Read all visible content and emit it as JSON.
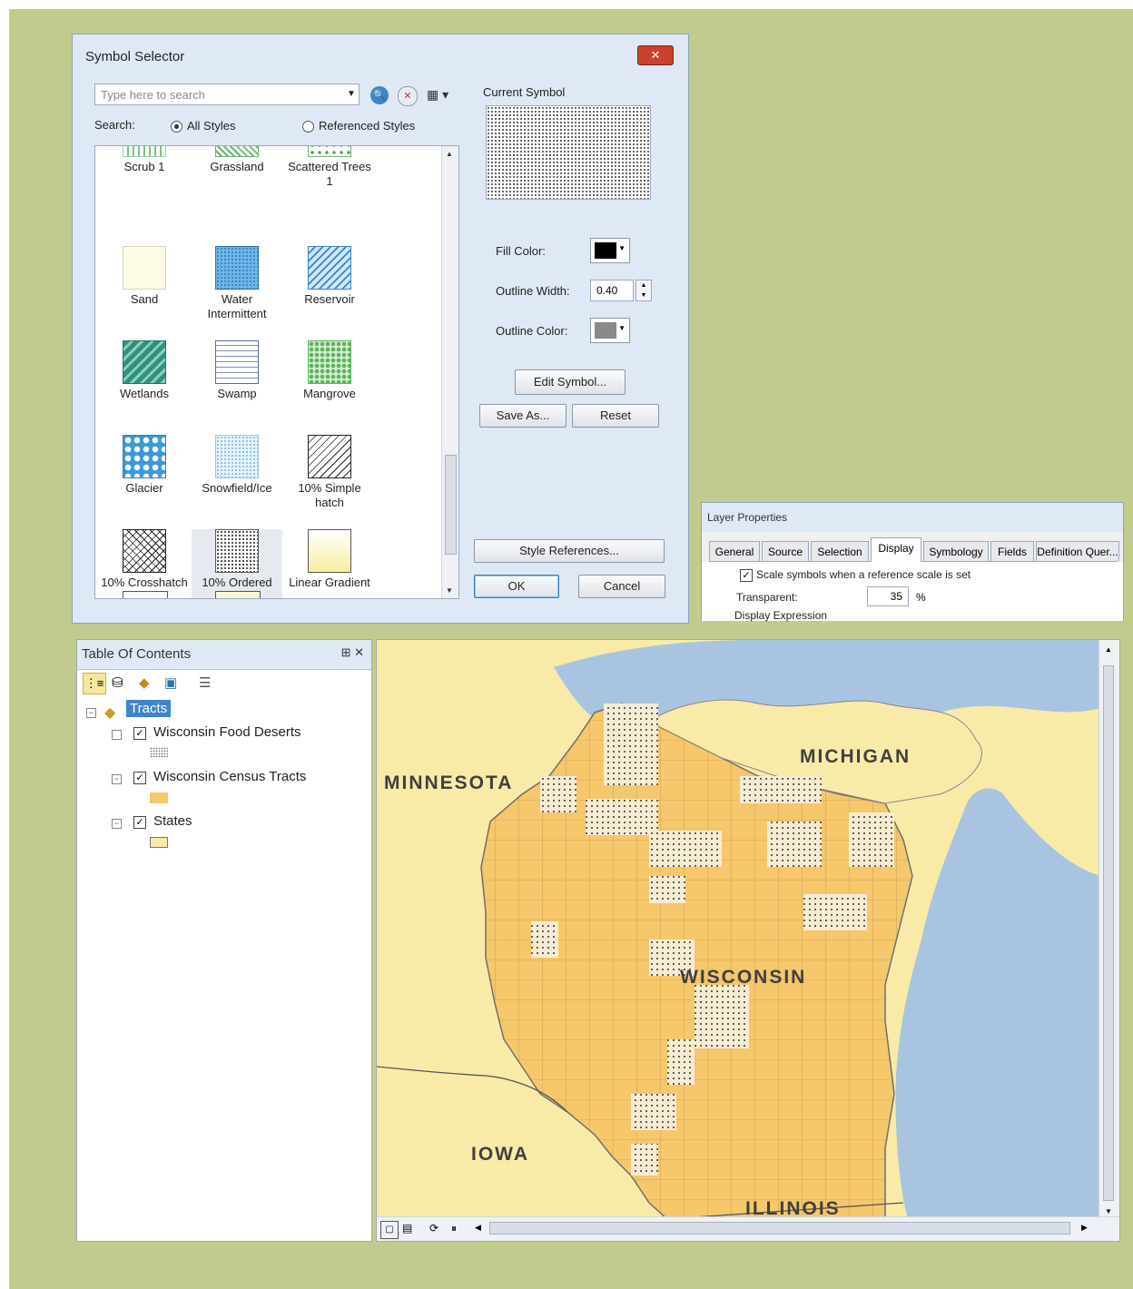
{
  "symbol_selector": {
    "title": "Symbol Selector",
    "close": "✕",
    "search_placeholder": "Type here to search",
    "search_label": "Search:",
    "radio_all": "All Styles",
    "radio_referenced": "Referenced Styles",
    "current_symbol_label": "Current Symbol",
    "fill_color_label": "Fill Color:",
    "outline_width_label": "Outline Width:",
    "outline_width_value": "0.40",
    "outline_color_label": "Outline Color:",
    "edit_symbol": "Edit Symbol...",
    "save_as": "Save As...",
    "reset": "Reset",
    "style_references": "Style References...",
    "ok": "OK",
    "cancel": "Cancel",
    "symbols": [
      {
        "name": "Scrub 1"
      },
      {
        "name": "Grassland"
      },
      {
        "name": "Scattered Trees 1"
      },
      {
        "name": "Sand"
      },
      {
        "name": "Water Intermittent"
      },
      {
        "name": "Reservoir"
      },
      {
        "name": "Wetlands"
      },
      {
        "name": "Swamp"
      },
      {
        "name": "Mangrove"
      },
      {
        "name": "Glacier"
      },
      {
        "name": "Snowfield/Ice"
      },
      {
        "name": "10% Simple hatch"
      },
      {
        "name": "10% Crosshatch"
      },
      {
        "name": "10% Ordered Stipple"
      },
      {
        "name": "Linear Gradient"
      }
    ]
  },
  "layer_properties": {
    "title": "Layer Properties",
    "tabs": [
      "General",
      "Source",
      "Selection",
      "Display",
      "Symbology",
      "Fields",
      "Definition Quer..."
    ],
    "active_tab": "Display",
    "scale_symbols": "Scale symbols when a reference scale is set",
    "transparent_label": "Transparent:",
    "transparent_value": "35",
    "transparent_unit": "%",
    "display_expression": "Display Expression"
  },
  "toc": {
    "title": "Table Of Contents",
    "pin": "⊞ ✕",
    "group": "Tracts",
    "layers": [
      {
        "name": "Wisconsin Food Deserts",
        "checked": true
      },
      {
        "name": "Wisconsin Census Tracts",
        "checked": true
      },
      {
        "name": "States",
        "checked": true
      }
    ]
  },
  "map": {
    "labels": {
      "minnesota": "MINNESOTA",
      "michigan": "MICHIGAN",
      "wisconsin": "WISCONSIN",
      "iowa": "IOWA",
      "illinois": "ILLINOIS"
    },
    "colors": {
      "land": "#f9eaa8",
      "tracts": "#f6c76b",
      "water": "#a8c4e0",
      "desert": "#f7ecd2"
    }
  }
}
